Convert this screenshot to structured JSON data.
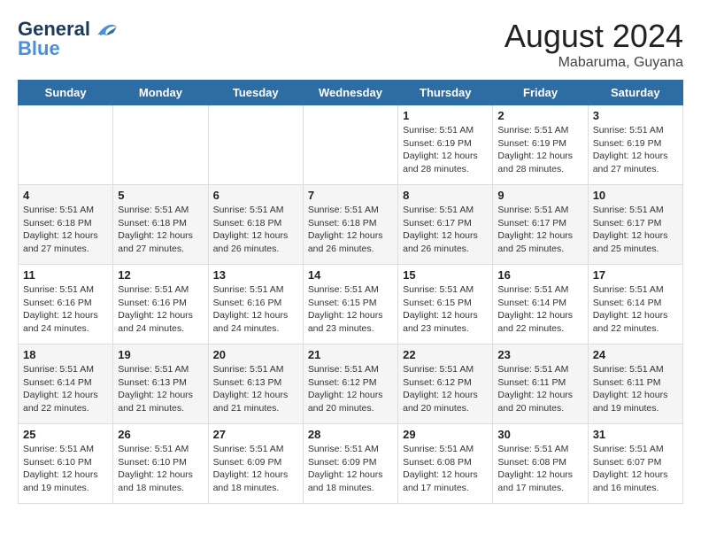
{
  "header": {
    "logo_line1": "General",
    "logo_line2": "Blue",
    "month_year": "August 2024",
    "location": "Mabaruma, Guyana"
  },
  "days_of_week": [
    "Sunday",
    "Monday",
    "Tuesday",
    "Wednesday",
    "Thursday",
    "Friday",
    "Saturday"
  ],
  "weeks": [
    [
      {
        "num": "",
        "info": ""
      },
      {
        "num": "",
        "info": ""
      },
      {
        "num": "",
        "info": ""
      },
      {
        "num": "",
        "info": ""
      },
      {
        "num": "1",
        "info": "Sunrise: 5:51 AM\nSunset: 6:19 PM\nDaylight: 12 hours\nand 28 minutes."
      },
      {
        "num": "2",
        "info": "Sunrise: 5:51 AM\nSunset: 6:19 PM\nDaylight: 12 hours\nand 28 minutes."
      },
      {
        "num": "3",
        "info": "Sunrise: 5:51 AM\nSunset: 6:19 PM\nDaylight: 12 hours\nand 27 minutes."
      }
    ],
    [
      {
        "num": "4",
        "info": "Sunrise: 5:51 AM\nSunset: 6:18 PM\nDaylight: 12 hours\nand 27 minutes."
      },
      {
        "num": "5",
        "info": "Sunrise: 5:51 AM\nSunset: 6:18 PM\nDaylight: 12 hours\nand 27 minutes."
      },
      {
        "num": "6",
        "info": "Sunrise: 5:51 AM\nSunset: 6:18 PM\nDaylight: 12 hours\nand 26 minutes."
      },
      {
        "num": "7",
        "info": "Sunrise: 5:51 AM\nSunset: 6:18 PM\nDaylight: 12 hours\nand 26 minutes."
      },
      {
        "num": "8",
        "info": "Sunrise: 5:51 AM\nSunset: 6:17 PM\nDaylight: 12 hours\nand 26 minutes."
      },
      {
        "num": "9",
        "info": "Sunrise: 5:51 AM\nSunset: 6:17 PM\nDaylight: 12 hours\nand 25 minutes."
      },
      {
        "num": "10",
        "info": "Sunrise: 5:51 AM\nSunset: 6:17 PM\nDaylight: 12 hours\nand 25 minutes."
      }
    ],
    [
      {
        "num": "11",
        "info": "Sunrise: 5:51 AM\nSunset: 6:16 PM\nDaylight: 12 hours\nand 24 minutes."
      },
      {
        "num": "12",
        "info": "Sunrise: 5:51 AM\nSunset: 6:16 PM\nDaylight: 12 hours\nand 24 minutes."
      },
      {
        "num": "13",
        "info": "Sunrise: 5:51 AM\nSunset: 6:16 PM\nDaylight: 12 hours\nand 24 minutes."
      },
      {
        "num": "14",
        "info": "Sunrise: 5:51 AM\nSunset: 6:15 PM\nDaylight: 12 hours\nand 23 minutes."
      },
      {
        "num": "15",
        "info": "Sunrise: 5:51 AM\nSunset: 6:15 PM\nDaylight: 12 hours\nand 23 minutes."
      },
      {
        "num": "16",
        "info": "Sunrise: 5:51 AM\nSunset: 6:14 PM\nDaylight: 12 hours\nand 22 minutes."
      },
      {
        "num": "17",
        "info": "Sunrise: 5:51 AM\nSunset: 6:14 PM\nDaylight: 12 hours\nand 22 minutes."
      }
    ],
    [
      {
        "num": "18",
        "info": "Sunrise: 5:51 AM\nSunset: 6:14 PM\nDaylight: 12 hours\nand 22 minutes."
      },
      {
        "num": "19",
        "info": "Sunrise: 5:51 AM\nSunset: 6:13 PM\nDaylight: 12 hours\nand 21 minutes."
      },
      {
        "num": "20",
        "info": "Sunrise: 5:51 AM\nSunset: 6:13 PM\nDaylight: 12 hours\nand 21 minutes."
      },
      {
        "num": "21",
        "info": "Sunrise: 5:51 AM\nSunset: 6:12 PM\nDaylight: 12 hours\nand 20 minutes."
      },
      {
        "num": "22",
        "info": "Sunrise: 5:51 AM\nSunset: 6:12 PM\nDaylight: 12 hours\nand 20 minutes."
      },
      {
        "num": "23",
        "info": "Sunrise: 5:51 AM\nSunset: 6:11 PM\nDaylight: 12 hours\nand 20 minutes."
      },
      {
        "num": "24",
        "info": "Sunrise: 5:51 AM\nSunset: 6:11 PM\nDaylight: 12 hours\nand 19 minutes."
      }
    ],
    [
      {
        "num": "25",
        "info": "Sunrise: 5:51 AM\nSunset: 6:10 PM\nDaylight: 12 hours\nand 19 minutes."
      },
      {
        "num": "26",
        "info": "Sunrise: 5:51 AM\nSunset: 6:10 PM\nDaylight: 12 hours\nand 18 minutes."
      },
      {
        "num": "27",
        "info": "Sunrise: 5:51 AM\nSunset: 6:09 PM\nDaylight: 12 hours\nand 18 minutes."
      },
      {
        "num": "28",
        "info": "Sunrise: 5:51 AM\nSunset: 6:09 PM\nDaylight: 12 hours\nand 18 minutes."
      },
      {
        "num": "29",
        "info": "Sunrise: 5:51 AM\nSunset: 6:08 PM\nDaylight: 12 hours\nand 17 minutes."
      },
      {
        "num": "30",
        "info": "Sunrise: 5:51 AM\nSunset: 6:08 PM\nDaylight: 12 hours\nand 17 minutes."
      },
      {
        "num": "31",
        "info": "Sunrise: 5:51 AM\nSunset: 6:07 PM\nDaylight: 12 hours\nand 16 minutes."
      }
    ]
  ]
}
